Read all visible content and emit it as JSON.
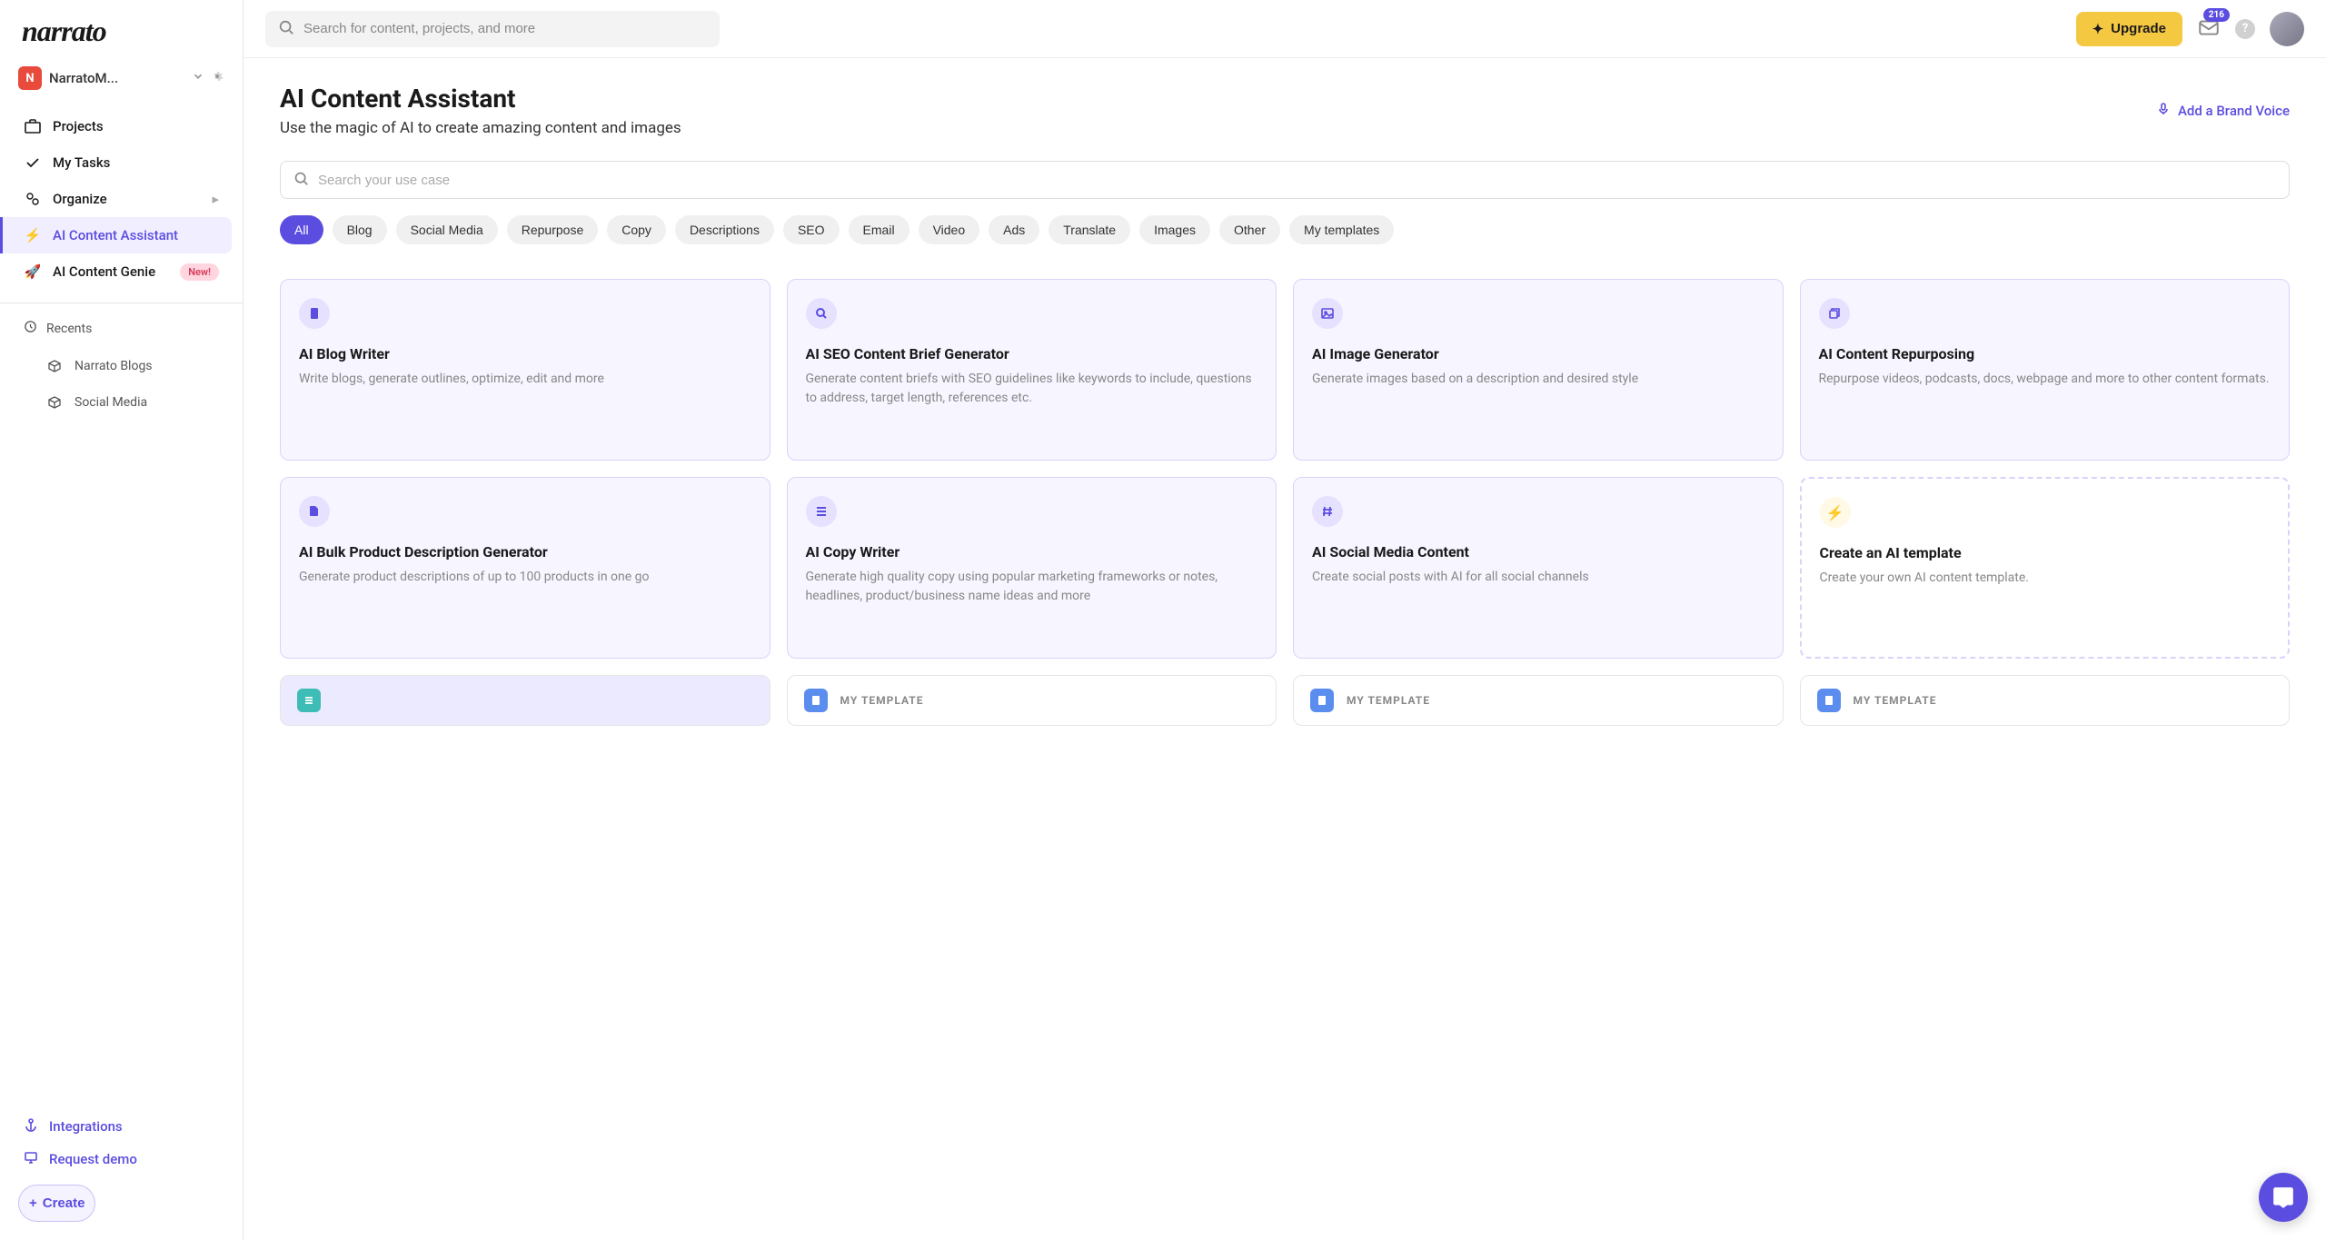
{
  "brand": "narrato",
  "workspace": {
    "initial": "N",
    "name": "NarratoM..."
  },
  "sidebar": {
    "items": [
      {
        "label": "Projects"
      },
      {
        "label": "My Tasks"
      },
      {
        "label": "Organize"
      },
      {
        "label": "AI Content Assistant"
      },
      {
        "label": "AI Content Genie",
        "badge": "New!"
      }
    ],
    "recents_label": "Recents",
    "recents": [
      {
        "label": "Narrato Blogs"
      },
      {
        "label": "Social Media"
      }
    ],
    "bottom": {
      "integrations": "Integrations",
      "demo": "Request demo",
      "create": "Create"
    }
  },
  "topbar": {
    "search_placeholder": "Search for content, projects, and more",
    "upgrade": "Upgrade",
    "mail_count": "216"
  },
  "page": {
    "title": "AI Content Assistant",
    "subtitle": "Use the magic of AI to create amazing content and images",
    "brand_voice": "Add a Brand Voice",
    "usecase_placeholder": "Search your use case"
  },
  "chips": [
    "All",
    "Blog",
    "Social Media",
    "Repurpose",
    "Copy",
    "Descriptions",
    "SEO",
    "Email",
    "Video",
    "Ads",
    "Translate",
    "Images",
    "Other",
    "My templates"
  ],
  "cards": [
    {
      "title": "AI Blog Writer",
      "desc": "Write blogs, generate outlines, optimize, edit and more"
    },
    {
      "title": "AI SEO Content Brief Generator",
      "desc": "Generate content briefs with SEO guidelines like keywords to include, questions to address, target length, references etc."
    },
    {
      "title": "AI Image Generator",
      "desc": "Generate images based on a description and desired style"
    },
    {
      "title": "AI Content Repurposing",
      "desc": "Repurpose videos, podcasts, docs, webpage and more to other content formats."
    },
    {
      "title": "AI Bulk Product Description Generator",
      "desc": "Generate product descriptions of up to 100 products in one go"
    },
    {
      "title": "AI Copy Writer",
      "desc": "Generate high quality copy using popular marketing frameworks or notes, headlines, product/business name ideas and more"
    },
    {
      "title": "AI Social Media Content",
      "desc": "Create social posts with AI for all social channels"
    },
    {
      "title": "Create an AI template",
      "desc": "Create your own AI content template."
    }
  ],
  "templates": {
    "label": "MY TEMPLATE"
  }
}
